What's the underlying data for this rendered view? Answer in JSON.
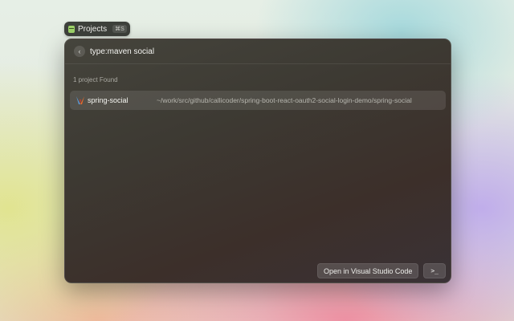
{
  "extension": {
    "title": "Projects",
    "shortcut": "⌘S",
    "icon": "folder-icon"
  },
  "search": {
    "query": "type:maven social",
    "back_icon": "chevron-left-icon"
  },
  "results": {
    "section_label": "1 project Found",
    "items": [
      {
        "icon": "maven-icon",
        "title": "spring-social",
        "path": "~/work/src/github/callicoder/spring-boot-react-oauth2-social-login-demo/spring-social"
      }
    ]
  },
  "actions": {
    "primary_label": "Open in Visual Studio Code",
    "terminal_label": ">_"
  },
  "colors": {
    "window_bg": "#3e3a34",
    "accent_icon": "#9ed36a"
  }
}
